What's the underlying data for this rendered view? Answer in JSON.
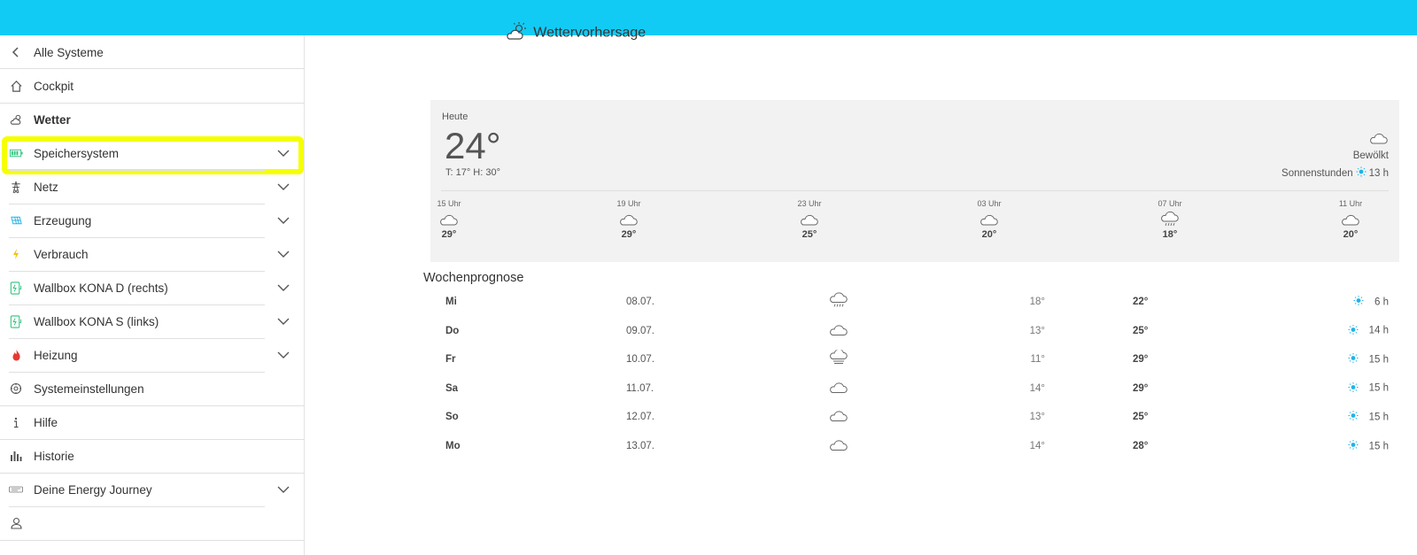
{
  "colors": {
    "topbar": "#12cbf5",
    "highlight": "#f5ff00",
    "sun": "#1fb4e8",
    "battery": "#2ec27e",
    "wallbox": "#2ec27e",
    "heating": "#e53935",
    "generation": "#1fb4e8",
    "consumption": "#f5c400"
  },
  "sidebar": {
    "back_label": "Alle Systeme",
    "items": [
      {
        "label": "Cockpit",
        "icon": "home-icon"
      },
      {
        "label": "Wetter",
        "icon": "weather-icon",
        "active": true
      },
      {
        "label": "Speichersystem",
        "icon": "battery-icon",
        "expandable": true
      },
      {
        "label": "Netz",
        "icon": "power-tower-icon",
        "expandable": true
      },
      {
        "label": "Erzeugung",
        "icon": "solar-panel-icon",
        "expandable": true
      },
      {
        "label": "Verbrauch",
        "icon": "lightning-icon",
        "expandable": true
      },
      {
        "label": "Wallbox KONA D (rechts)",
        "icon": "wallbox-icon",
        "expandable": true
      },
      {
        "label": "Wallbox KONA S (links)",
        "icon": "wallbox-icon",
        "expandable": true
      },
      {
        "label": "Heizung",
        "icon": "flame-icon",
        "expandable": true
      },
      {
        "label": "Systemeinstellungen",
        "icon": "settings-icon"
      },
      {
        "label": "Hilfe",
        "icon": "info-icon"
      },
      {
        "label": "Historie",
        "icon": "bar-chart-icon"
      },
      {
        "label": "Deine Energy Journey",
        "icon": "journey-icon",
        "expandable": true
      },
      {
        "label": "",
        "icon": "user-icon"
      }
    ]
  },
  "main": {
    "title": "Wettervorhersage",
    "today": {
      "label": "Heute",
      "temp": "24°",
      "range": "T: 17° H: 30°",
      "condition": "Bewölkt",
      "sun_label": "Sonnenstunden",
      "sun_hours": "13 h",
      "hours": [
        {
          "time": "15 Uhr",
          "temp": "29°",
          "icon": "cloud-icon"
        },
        {
          "time": "19 Uhr",
          "temp": "29°",
          "icon": "cloud-icon"
        },
        {
          "time": "23 Uhr",
          "temp": "25°",
          "icon": "cloud-icon"
        },
        {
          "time": "03 Uhr",
          "temp": "20°",
          "icon": "cloud-icon"
        },
        {
          "time": "07 Uhr",
          "temp": "18°",
          "icon": "cloud-rain-icon"
        },
        {
          "time": "11 Uhr",
          "temp": "20°",
          "icon": "cloud-icon"
        }
      ]
    },
    "week_title": "Wochenprognose",
    "week": [
      {
        "day": "Mi",
        "date": "08.07.",
        "icon": "cloud-rain-icon",
        "low": "18°",
        "high": "22°",
        "sun": "6 h"
      },
      {
        "day": "Do",
        "date": "09.07.",
        "icon": "cloud-icon",
        "low": "13°",
        "high": "25°",
        "sun": "14 h"
      },
      {
        "day": "Fr",
        "date": "10.07.",
        "icon": "cloud-fog-icon",
        "low": "11°",
        "high": "29°",
        "sun": "15 h"
      },
      {
        "day": "Sa",
        "date": "11.07.",
        "icon": "cloud-icon",
        "low": "14°",
        "high": "29°",
        "sun": "15 h"
      },
      {
        "day": "So",
        "date": "12.07.",
        "icon": "cloud-icon",
        "low": "13°",
        "high": "25°",
        "sun": "15 h"
      },
      {
        "day": "Mo",
        "date": "13.07.",
        "icon": "cloud-icon",
        "low": "14°",
        "high": "28°",
        "sun": "15 h"
      }
    ]
  }
}
